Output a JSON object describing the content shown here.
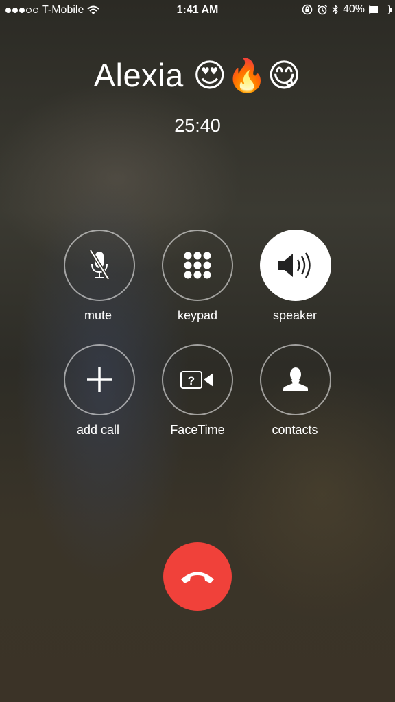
{
  "status_bar": {
    "signal_dots": [
      true,
      true,
      true,
      false,
      false
    ],
    "carrier": "T-Mobile",
    "time": "1:41 AM",
    "battery_percent": "40%",
    "battery_level": 0.4
  },
  "call": {
    "caller_name": "Alexia 😍🔥😋",
    "duration": "25:40"
  },
  "controls": {
    "mute": "mute",
    "keypad": "keypad",
    "speaker": "speaker",
    "add_call": "add call",
    "facetime": "FaceTime",
    "contacts": "contacts"
  },
  "colors": {
    "end_call": "#f0413a",
    "active_button": "#ffffff"
  }
}
